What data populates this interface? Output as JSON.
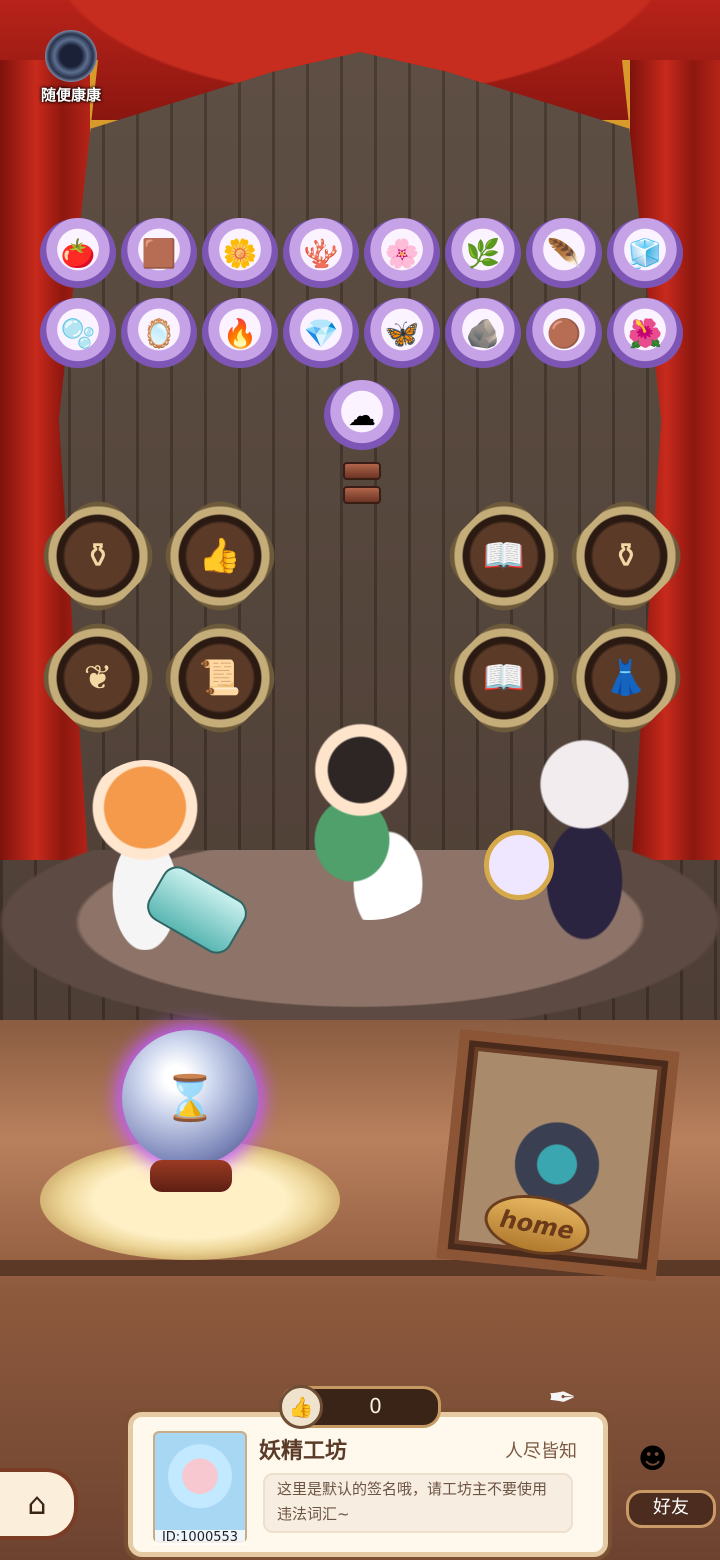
{
  "game": {
    "logo_text": "随便康康"
  },
  "materials": {
    "row1": [
      {
        "icon": "tomato-icon",
        "glyph": "🍅"
      },
      {
        "icon": "chocolate-icon",
        "glyph": "🟫"
      },
      {
        "icon": "yellow-flower-icon",
        "glyph": "🌼"
      },
      {
        "icon": "red-coral-icon",
        "glyph": "🪸"
      },
      {
        "icon": "purple-flower-icon",
        "glyph": "🌸"
      },
      {
        "icon": "herb-icon",
        "glyph": "🌿"
      },
      {
        "icon": "black-beak-icon",
        "glyph": "🪶"
      },
      {
        "icon": "white-cube-icon",
        "glyph": "🧊"
      }
    ],
    "row2": [
      {
        "icon": "blue-slime-icon",
        "glyph": "🫧"
      },
      {
        "icon": "magic-mirror-icon",
        "glyph": "🪞"
      },
      {
        "icon": "fire-ore-icon",
        "glyph": "🔥"
      },
      {
        "icon": "crystal-cloud-icon",
        "glyph": "💎"
      },
      {
        "icon": "butterfly-wing-icon",
        "glyph": "🦋"
      },
      {
        "icon": "dark-stone-icon",
        "glyph": "🪨"
      },
      {
        "icon": "mud-pile-icon",
        "glyph": "🟤"
      },
      {
        "icon": "blue-flower-icon",
        "glyph": "🌺"
      }
    ],
    "row3": [
      {
        "icon": "white-cloud-icon",
        "glyph": "☁"
      }
    ]
  },
  "badges": [
    {
      "icon": "cauldron-icon",
      "glyph": "⚱"
    },
    {
      "icon": "thumbs-up-sprout-icon",
      "glyph": "👍"
    },
    {
      "icon": "book-icon",
      "glyph": "📖"
    },
    {
      "icon": "cauldron-sparkle-icon",
      "glyph": "⚱"
    },
    {
      "icon": "flower-crest-icon",
      "glyph": "❦"
    },
    {
      "icon": "certificate-icon",
      "glyph": "📜"
    },
    {
      "icon": "book-icon",
      "glyph": "📖"
    },
    {
      "icon": "dress-icon",
      "glyph": "👗"
    }
  ],
  "orb": {
    "icon": "hourglass-icon",
    "glyph": "⌛"
  },
  "frame": {
    "label": "home"
  },
  "likes": {
    "count": "0",
    "icon": "thumbs-up-icon",
    "glyph": "👍"
  },
  "profile": {
    "shop_name": "妖精工坊",
    "slogan": "人尽皆知",
    "signature": "这里是默认的签名哦，请工坊主不要使用违法词汇~",
    "id": "ID:1000553"
  },
  "nav": {
    "home_glyph": "⌂",
    "friends_label": "好友"
  }
}
